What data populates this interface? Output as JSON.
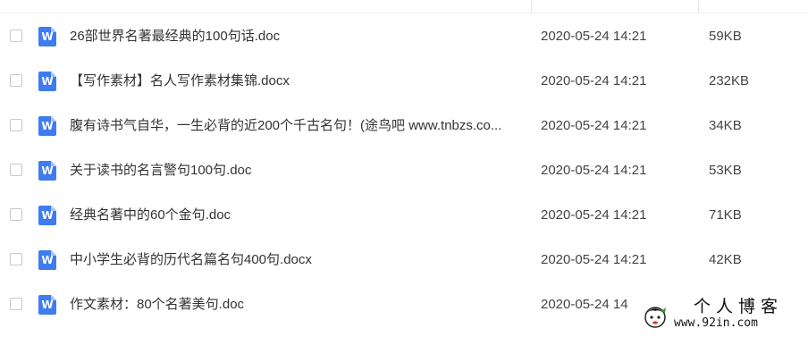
{
  "files": [
    {
      "name": "26部世界名著最经典的100句话.doc",
      "date": "2020-05-24 14:21",
      "size": "59KB",
      "icon": "word-doc-icon"
    },
    {
      "name": "【写作素材】名人写作素材集锦.docx",
      "date": "2020-05-24 14:21",
      "size": "232KB",
      "icon": "word-doc-icon"
    },
    {
      "name": "腹有诗书气自华，一生必背的近200个千古名句！(途鸟吧 www.tnbzs.co...",
      "date": "2020-05-24 14:21",
      "size": "34KB",
      "icon": "word-doc-icon"
    },
    {
      "name": "关于读书的名言警句100句.doc",
      "date": "2020-05-24 14:21",
      "size": "53KB",
      "icon": "word-doc-icon"
    },
    {
      "name": "经典名著中的60个金句.doc",
      "date": "2020-05-24 14:21",
      "size": "71KB",
      "icon": "word-doc-icon"
    },
    {
      "name": "中小学生必背的历代名篇名句400句.docx",
      "date": "2020-05-24 14:21",
      "size": "42KB",
      "icon": "word-doc-icon"
    },
    {
      "name": "作文素材：80个名著美句.doc",
      "date": "2020-05-24 14",
      "size": "",
      "icon": "word-doc-icon"
    }
  ],
  "icon_glyph": "W",
  "watermark": {
    "title": "个人博客",
    "url": "www.92in.com"
  },
  "colors": {
    "word_icon": "#3e7cf0",
    "text": "#333333",
    "checkbox_border": "#c8c8c8"
  }
}
